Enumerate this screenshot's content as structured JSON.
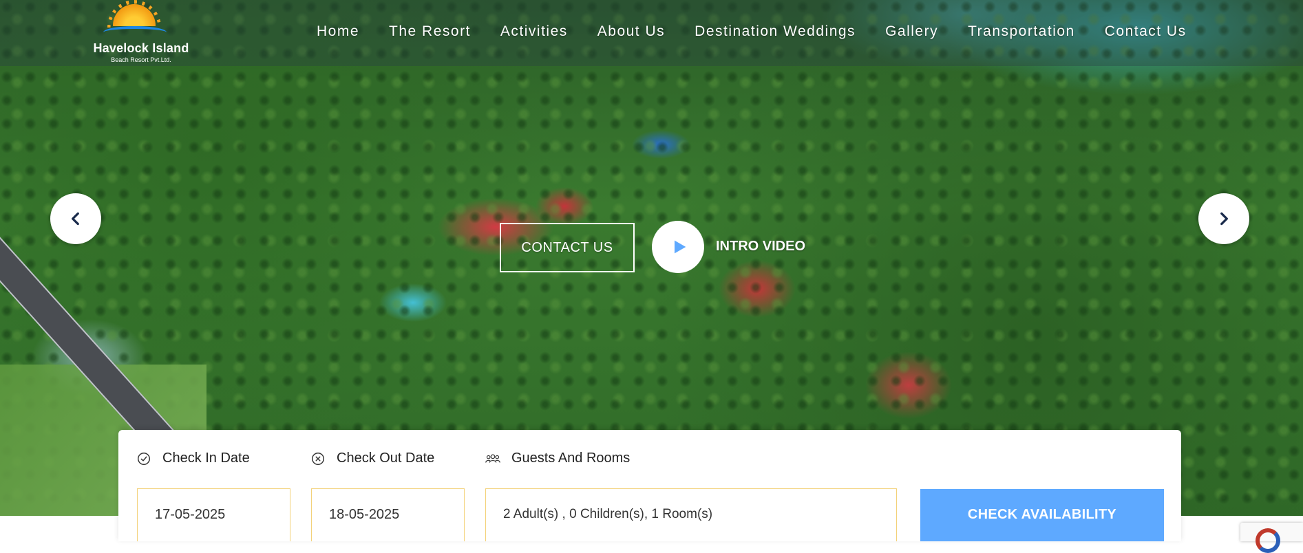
{
  "logo": {
    "title": "Havelock Island",
    "subtitle": "Beach Resort Pvt.Ltd.",
    "icon": "sun-wave-logo"
  },
  "nav": {
    "items": [
      {
        "label": "Home"
      },
      {
        "label": "The Resort"
      },
      {
        "label": "Activities"
      },
      {
        "label": "About Us"
      },
      {
        "label": "Destination Weddings"
      },
      {
        "label": "Gallery"
      },
      {
        "label": "Transportation"
      },
      {
        "label": "Contact Us"
      }
    ]
  },
  "hero": {
    "contact_label": "CONTACT US",
    "intro_label": "INTRO VIDEO",
    "prev_icon": "chevron-left-icon",
    "next_icon": "chevron-right-icon",
    "play_icon": "play-icon"
  },
  "booking": {
    "check_in_label": "Check In Date",
    "check_out_label": "Check Out Date",
    "guests_label": "Guests And Rooms",
    "check_in_value": "17-05-2025",
    "check_out_value": "18-05-2025",
    "guests_value": "2 Adult(s) , 0 Children(s), 1 Room(s)",
    "submit_label": "CHECK AVAILABILITY"
  },
  "colors": {
    "accent": "#5ea9ff",
    "field_border": "#f3d27a"
  }
}
